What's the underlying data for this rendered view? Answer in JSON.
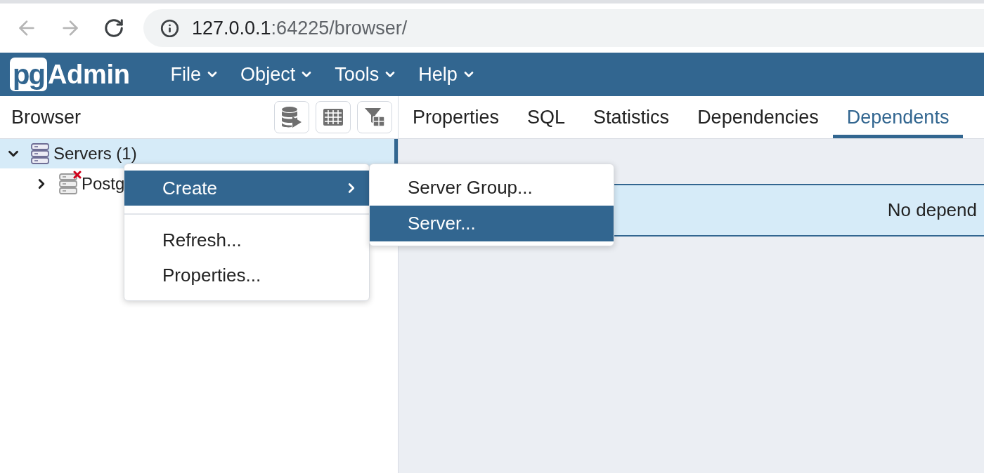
{
  "browser": {
    "nav_buttons": [
      {
        "kind": "back",
        "disabled": true
      },
      {
        "kind": "forward",
        "disabled": true
      },
      {
        "kind": "reload",
        "disabled": false
      }
    ],
    "url": {
      "host": "127.0.0.1",
      "rest": ":64225/browser/"
    }
  },
  "app_bar": {
    "logo": {
      "mark": "pg",
      "text": "Admin"
    },
    "menus": [
      {
        "label": "File"
      },
      {
        "label": "Object"
      },
      {
        "label": "Tools"
      },
      {
        "label": "Help"
      }
    ]
  },
  "browser_panel": {
    "title": "Browser",
    "tree": [
      {
        "kind": "server_group",
        "label": "Servers (1)",
        "expanded": true,
        "selected": true,
        "children": [
          {
            "kind": "server",
            "label": "Postg",
            "expanded": false,
            "selected": false,
            "connected": false
          }
        ]
      }
    ]
  },
  "detail_panel": {
    "tabs": [
      {
        "label": "Properties",
        "selected": false
      },
      {
        "label": "SQL",
        "selected": false
      },
      {
        "label": "Statistics",
        "selected": false
      },
      {
        "label": "Dependencies",
        "selected": false
      },
      {
        "label": "Dependents",
        "selected": true
      }
    ],
    "message": "No depend"
  },
  "context_menu": {
    "items": [
      {
        "kind": "submenu",
        "label": "Create",
        "selected": true
      },
      {
        "kind": "separator"
      },
      {
        "kind": "item",
        "label": "Refresh...",
        "selected": false
      },
      {
        "kind": "item",
        "label": "Properties...",
        "selected": false
      }
    ],
    "submenu": {
      "items": [
        {
          "label": "Server Group...",
          "selected": false
        },
        {
          "label": "Server...",
          "selected": true
        }
      ]
    }
  }
}
